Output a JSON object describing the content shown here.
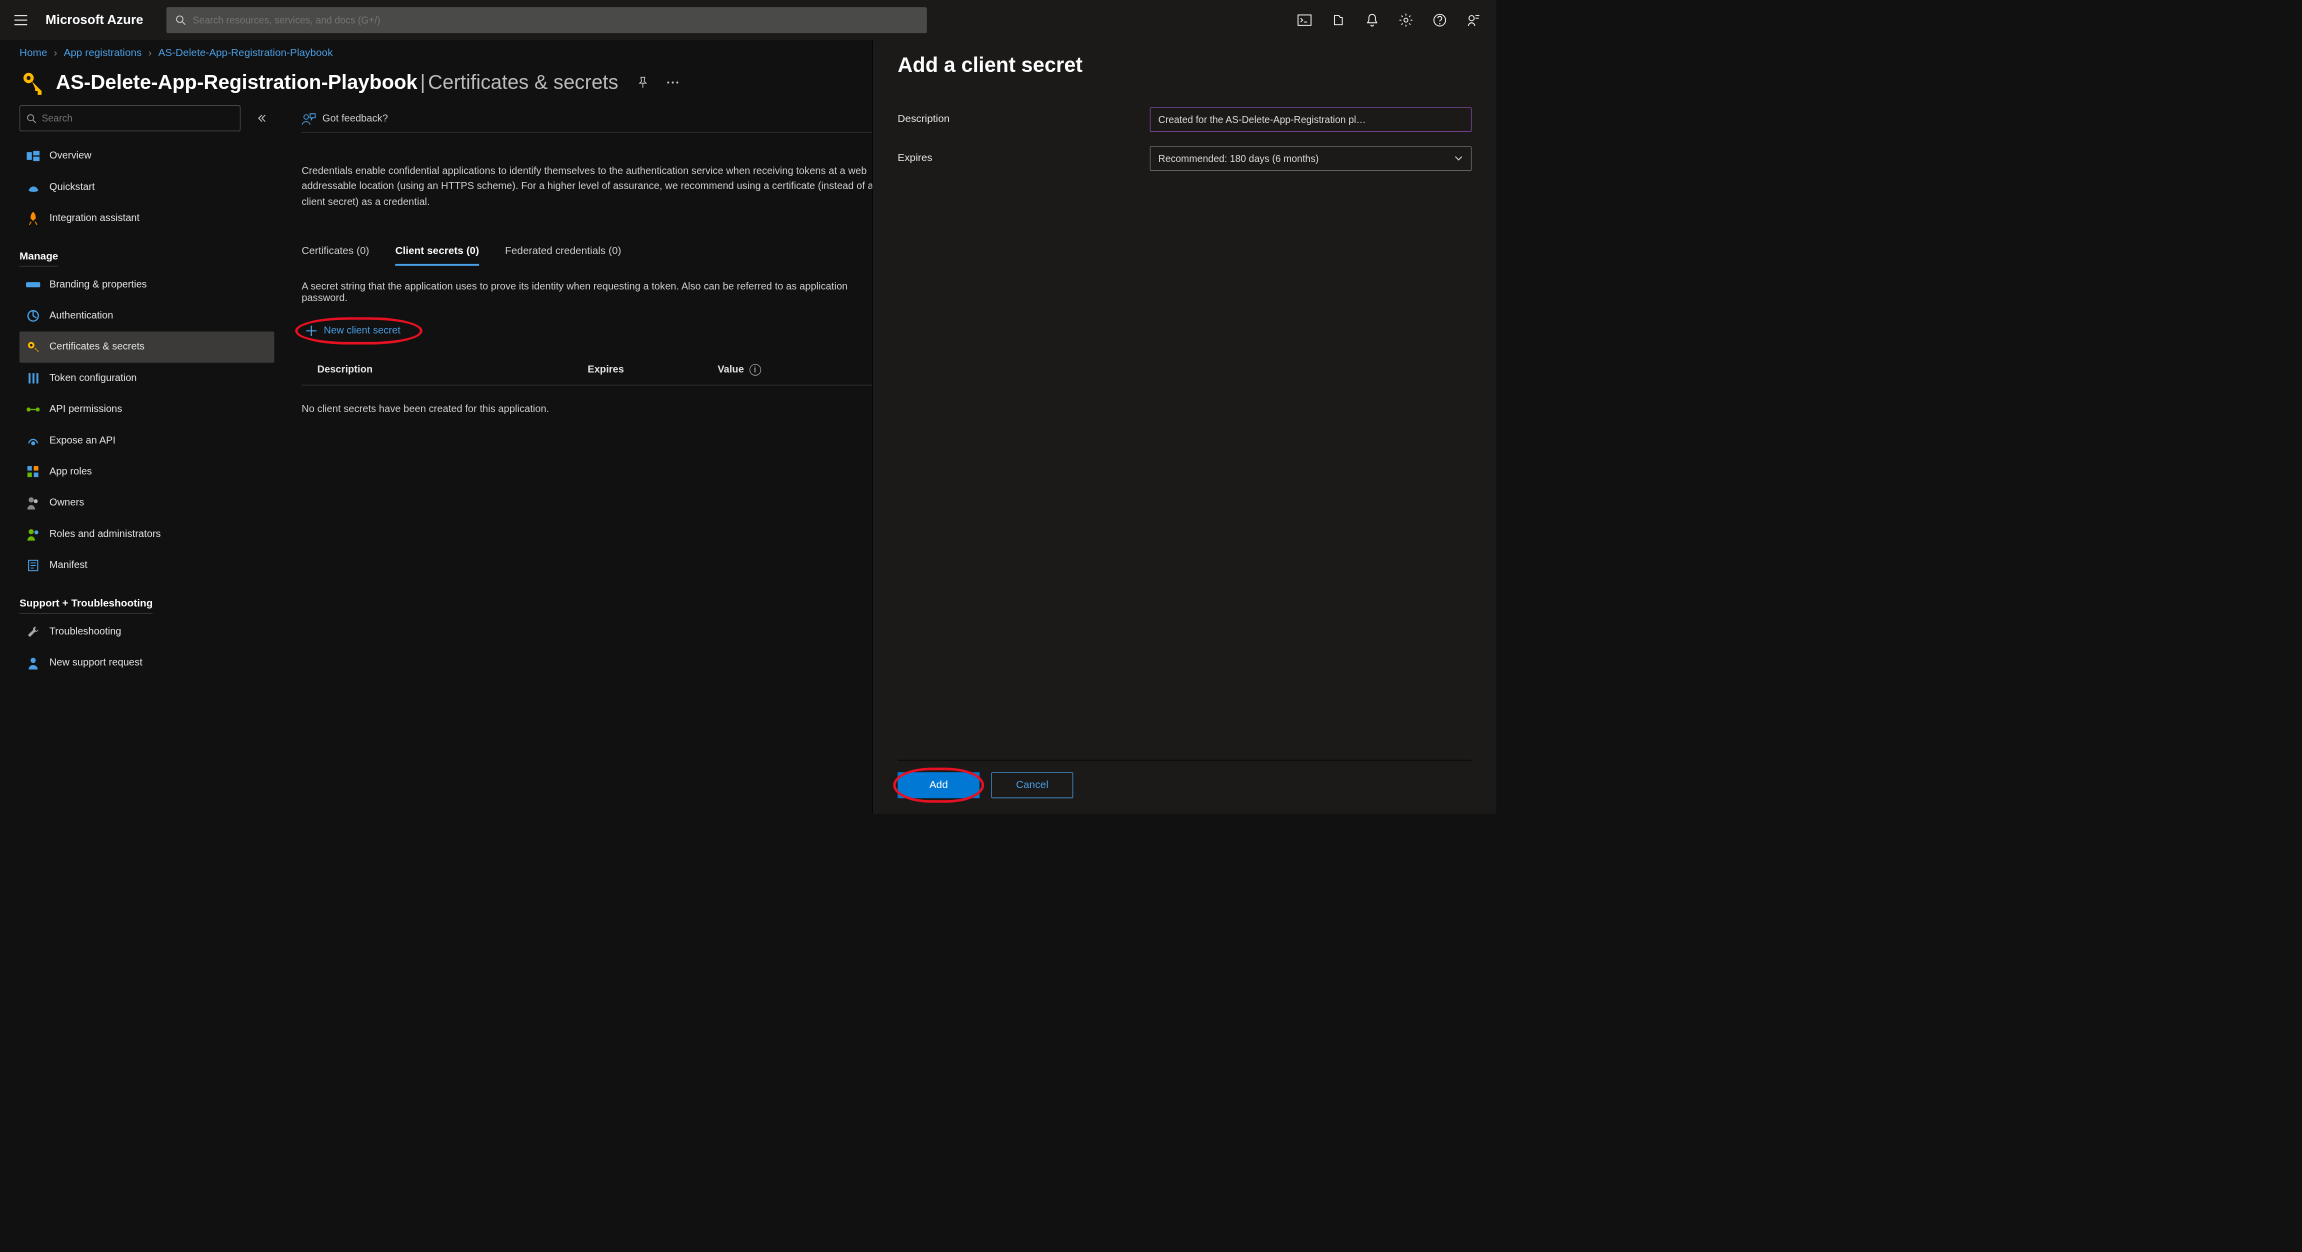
{
  "header": {
    "brand": "Microsoft Azure",
    "search_placeholder": "Search resources, services, and docs (G+/)"
  },
  "breadcrumbs": {
    "home": "Home",
    "apps": "App registrations",
    "current": "AS-Delete-App-Registration-Playbook"
  },
  "title": {
    "app": "AS-Delete-App-Registration-Playbook",
    "divider": " | ",
    "section": "Certificates & secrets"
  },
  "sidebar": {
    "search_placeholder": "Search",
    "top_items": [
      {
        "label": "Overview",
        "icon": "overview",
        "color": "#4aa0e6"
      },
      {
        "label": "Quickstart",
        "icon": "quickstart",
        "color": "#4aa0e6"
      },
      {
        "label": "Integration assistant",
        "icon": "rocket",
        "color": "#ff8c00"
      }
    ],
    "manage_label": "Manage",
    "manage_items": [
      {
        "label": "Branding & properties",
        "icon": "branding",
        "color": "#4aa0e6"
      },
      {
        "label": "Authentication",
        "icon": "auth",
        "color": "#4aa0e6"
      },
      {
        "label": "Certificates & secrets",
        "icon": "key",
        "color": "#ffb900",
        "active": true
      },
      {
        "label": "Token configuration",
        "icon": "token",
        "color": "#4aa0e6"
      },
      {
        "label": "API permissions",
        "icon": "api",
        "color": "#6bb700"
      },
      {
        "label": "Expose an API",
        "icon": "expose",
        "color": "#4aa0e6"
      },
      {
        "label": "App roles",
        "icon": "roles",
        "color": "#4aa0e6"
      },
      {
        "label": "Owners",
        "icon": "owners",
        "color": "#888"
      },
      {
        "label": "Roles and administrators",
        "icon": "radmin",
        "color": "#6bb700"
      },
      {
        "label": "Manifest",
        "icon": "manifest",
        "color": "#4aa0e6"
      }
    ],
    "support_label": "Support + Troubleshooting",
    "support_items": [
      {
        "label": "Troubleshooting",
        "icon": "wrench",
        "color": "#aaa"
      },
      {
        "label": "New support request",
        "icon": "support",
        "color": "#4aa0e6"
      }
    ]
  },
  "main": {
    "feedback": "Got feedback?",
    "intro": "Credentials enable confidential applications to identify themselves to the authentication service when receiving tokens at a web addressable location (using an HTTPS scheme). For a higher level of assurance, we recommend using a certificate (instead of a client secret) as a credential.",
    "tabs": {
      "cert": "Certificates (0)",
      "secret": "Client secrets (0)",
      "fed": "Federated credentials (0)"
    },
    "tabdesc": "A secret string that the application uses to prove its identity when requesting a token. Also can be referred to as application password.",
    "new_secret": "New client secret",
    "cols": {
      "desc": "Description",
      "exp": "Expires",
      "val": "Value"
    },
    "empty": "No client secrets have been created for this application."
  },
  "panel": {
    "title": "Add a client secret",
    "desc_label": "Description",
    "desc_value": "Created for the AS-Delete-App-Registration pl…",
    "exp_label": "Expires",
    "exp_value": "Recommended: 180 days (6 months)",
    "add": "Add",
    "cancel": "Cancel"
  }
}
